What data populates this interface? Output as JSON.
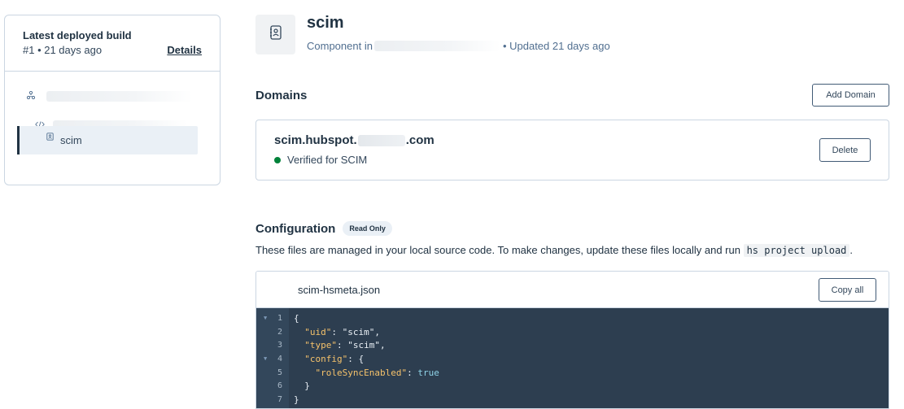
{
  "sidebar": {
    "build_title": "Latest deployed build",
    "build_meta": "#1 • 21 days ago",
    "details_label": "Details",
    "tree": [
      {
        "icon": "project-icon",
        "label": ""
      },
      {
        "icon": "code-icon",
        "label": ""
      },
      {
        "icon": "component-icon",
        "label": "scim",
        "selected": true
      }
    ]
  },
  "header": {
    "title": "scim",
    "subtitle_prefix": "Component in",
    "subtitle_suffix": "• Updated 21 days ago"
  },
  "domains": {
    "title": "Domains",
    "add_label": "Add Domain",
    "items": [
      {
        "name_prefix": "scim.hubspot.",
        "name_suffix": ".com",
        "status": "Verified for SCIM",
        "status_color": "#00823a",
        "delete_label": "Delete"
      }
    ]
  },
  "configuration": {
    "title": "Configuration",
    "badge": "Read Only",
    "desc_prefix": "These files are managed in your local source code. To make changes, update these files locally and run",
    "desc_command": "hs project upload",
    "desc_suffix": ".",
    "file_name": "scim-hsmeta.json",
    "copy_label": "Copy all",
    "code_lines": [
      {
        "n": "1",
        "text": "{"
      },
      {
        "n": "2",
        "text": "  \"uid\": \"scim\","
      },
      {
        "n": "3",
        "text": "  \"type\": \"scim\","
      },
      {
        "n": "4",
        "text": "  \"config\": {"
      },
      {
        "n": "5",
        "text": "    \"roleSyncEnabled\": true"
      },
      {
        "n": "6",
        "text": "  }"
      },
      {
        "n": "7",
        "text": "}"
      }
    ]
  }
}
